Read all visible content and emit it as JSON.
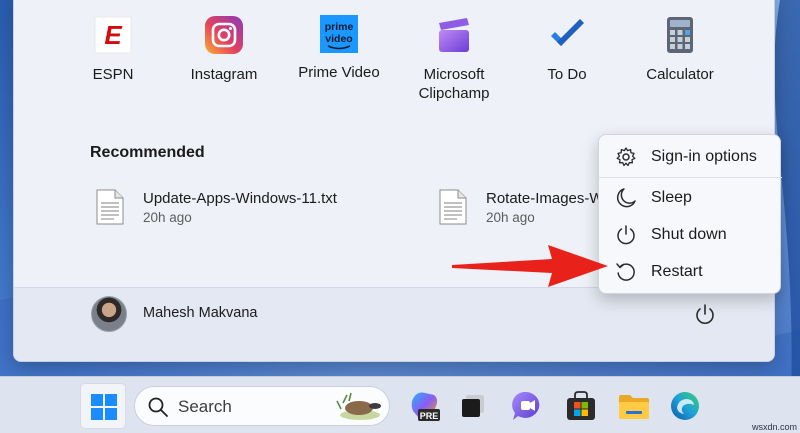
{
  "pinned_apps": [
    {
      "label": "ESPN",
      "icon": "espn-icon"
    },
    {
      "label": "Instagram",
      "icon": "instagram-icon"
    },
    {
      "label": "Prime Video",
      "icon": "prime-video-icon",
      "icon_text_top": "prime",
      "icon_text_bottom": "video"
    },
    {
      "label": "Microsoft Clipchamp",
      "icon": "clipchamp-icon"
    },
    {
      "label": "To Do",
      "icon": "todo-icon"
    },
    {
      "label": "Calculator",
      "icon": "calculator-icon"
    }
  ],
  "recommended": {
    "title": "Recommended",
    "items": [
      {
        "name": "Update-Apps-Windows-11.txt",
        "time": "20h ago"
      },
      {
        "name": "Rotate-Images-W",
        "time": "20h ago"
      }
    ]
  },
  "user": {
    "name": "Mahesh Makvana"
  },
  "power_menu": {
    "items": [
      {
        "label": "Sign-in options",
        "icon": "gear-icon"
      },
      {
        "label": "Sleep",
        "icon": "moon-icon"
      },
      {
        "label": "Shut down",
        "icon": "power-icon"
      },
      {
        "label": "Restart",
        "icon": "restart-icon"
      }
    ]
  },
  "taskbar": {
    "search_placeholder": "Search",
    "icons": [
      "windows-start-icon",
      "search-icon",
      "copilot-pre-icon",
      "task-view-icon",
      "teams-chat-icon",
      "microsoft-store-icon",
      "file-explorer-icon",
      "edge-icon"
    ],
    "copilot_badge": "PRE"
  },
  "colors": {
    "arrow": "#e8221b",
    "start_bg": "#eef1f8",
    "flyout_bg": "#f7f8fb"
  },
  "watermark": "wsxdn.com"
}
